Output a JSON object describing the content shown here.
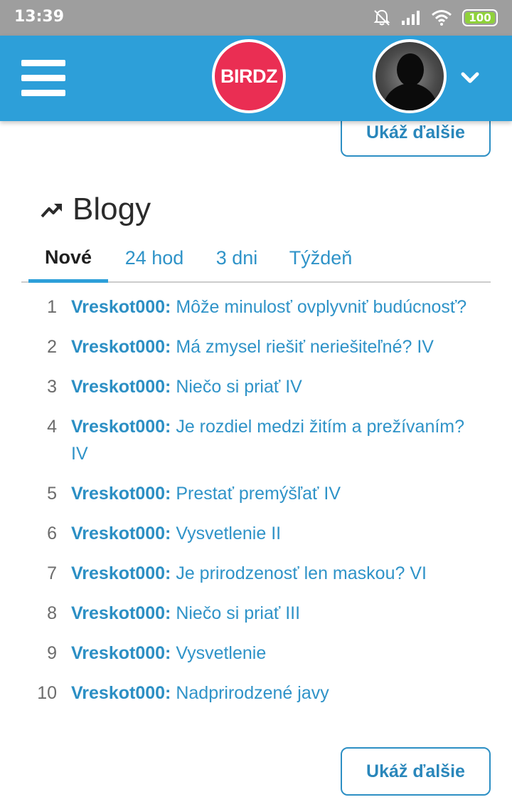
{
  "status_bar": {
    "time": "13:39",
    "icons": [
      "bell-off-icon",
      "signal-icon",
      "wifi-icon"
    ],
    "battery": "100",
    "battery_color": "#8fd13a"
  },
  "header": {
    "logo_text": "BIRDZ",
    "logo_color": "#ea2e53",
    "bar_color": "#2d9fd9"
  },
  "top_button_label": "Ukáž ďalšie",
  "section": {
    "title": "Blogy",
    "tabs": [
      {
        "label": "Nové",
        "active": true
      },
      {
        "label": "24 hod",
        "active": false
      },
      {
        "label": "3 dni",
        "active": false
      },
      {
        "label": "Týždeň",
        "active": false
      }
    ]
  },
  "blogs": [
    {
      "num": "1",
      "author": "Vreskot000:",
      "title": "Môže minulosť ovplyvniť budúcnosť?"
    },
    {
      "num": "2",
      "author": "Vreskot000:",
      "title": "Má zmysel riešiť neriešiteľné? IV"
    },
    {
      "num": "3",
      "author": "Vreskot000:",
      "title": "Niečo si priať IV"
    },
    {
      "num": "4",
      "author": "Vreskot000:",
      "title": "Je rozdiel medzi žitím a prežívaním? IV"
    },
    {
      "num": "5",
      "author": "Vreskot000:",
      "title": "Prestať premýšľať IV"
    },
    {
      "num": "6",
      "author": "Vreskot000:",
      "title": "Vysvetlenie II"
    },
    {
      "num": "7",
      "author": "Vreskot000:",
      "title": "Je prirodzenosť len maskou? VI"
    },
    {
      "num": "8",
      "author": "Vreskot000:",
      "title": "Niečo si priať III"
    },
    {
      "num": "9",
      "author": "Vreskot000:",
      "title": "Vysvetlenie"
    },
    {
      "num": "10",
      "author": "Vreskot000:",
      "title": "Nadprirodzené javy"
    }
  ],
  "bottom_button_label": "Ukáž ďalšie"
}
